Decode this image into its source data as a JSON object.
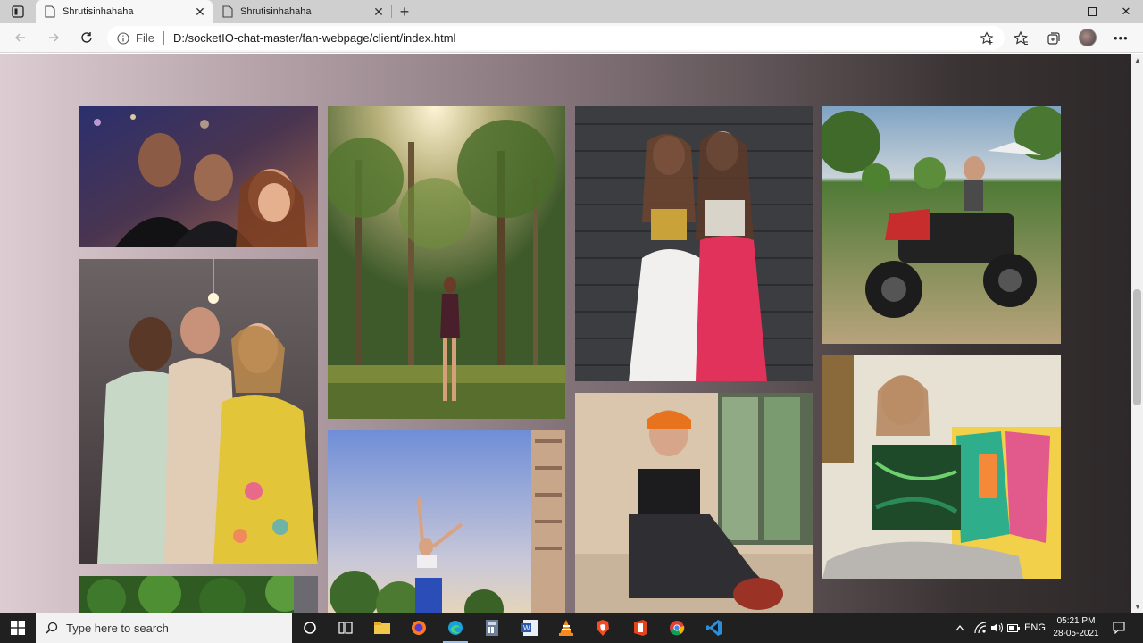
{
  "browser": {
    "tabs": [
      {
        "title": "Shrutisinhahaha",
        "active": true
      },
      {
        "title": "Shrutisinhahaha",
        "active": false
      }
    ],
    "address": {
      "scheme": "File",
      "url": "D:/socketIO-chat-master/fan-webpage/client/index.html"
    },
    "icons": [
      "tab-actions-icon",
      "page-icon",
      "close-icon",
      "new-tab-icon",
      "minimize-icon",
      "maximize-icon",
      "close-window-icon",
      "back-icon",
      "forward-icon",
      "refresh-icon",
      "info-icon",
      "add-favorite-icon",
      "favorites-icon",
      "collections-icon",
      "profile-avatar",
      "more-icon"
    ]
  },
  "gallery": {
    "background": {
      "from": "#dccdd2",
      "to": "#2d2829"
    },
    "photos": [
      {
        "name": "photo-group-selfie-party"
      },
      {
        "name": "photo-group-hug-yellow-lehenga"
      },
      {
        "name": "photo-park-trees"
      },
      {
        "name": "photo-sky-celebration"
      },
      {
        "name": "photo-two-women-brick-wall"
      },
      {
        "name": "photo-mirror-selfie-orange-beanie"
      },
      {
        "name": "photo-atv-ride"
      },
      {
        "name": "photo-painting-canvas"
      },
      {
        "name": "photo-greenery-partial"
      }
    ]
  },
  "taskbar": {
    "search_placeholder": "Type here to search",
    "apps": [
      "cortana-icon",
      "task-view-icon",
      "file-explorer-icon",
      "firefox-icon",
      "edge-icon",
      "calculator-icon",
      "word-icon",
      "vlc-icon",
      "brave-icon",
      "office-icon",
      "chrome-icon",
      "vscode-icon"
    ],
    "tray": {
      "language": "ENG",
      "time": "05:21 PM",
      "date": "28-05-2021"
    }
  }
}
